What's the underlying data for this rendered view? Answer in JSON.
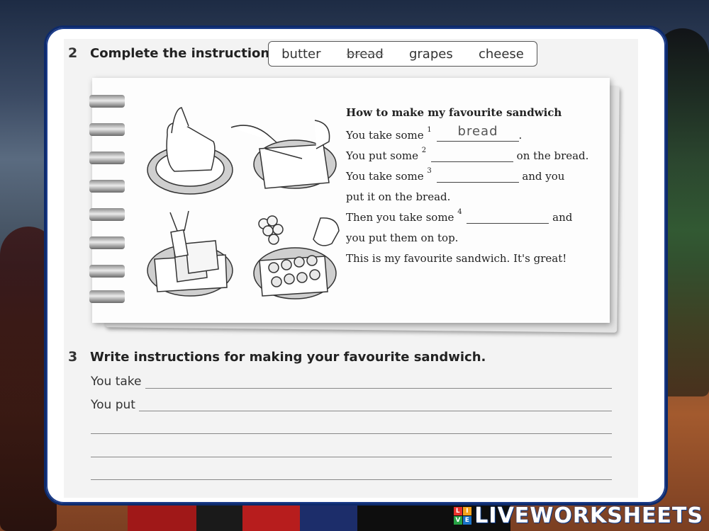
{
  "exercise2": {
    "number": "2",
    "heading": "Complete the instructions.",
    "word_bank": [
      "butter",
      "bread",
      "grapes",
      "cheese"
    ],
    "used_word_index": 1
  },
  "notebook": {
    "title": "How to make my favourite sandwich",
    "lines": [
      {
        "pre": "You take some",
        "num": "1",
        "post": ".",
        "answer": "bread"
      },
      {
        "pre": "You put some",
        "num": "2",
        "post": "on the bread.",
        "answer": ""
      },
      {
        "pre": "You take some",
        "num": "3",
        "post": "and you",
        "answer": ""
      },
      {
        "pre": "put it on the bread.",
        "num": "",
        "post": "",
        "answer": ""
      },
      {
        "pre": "Then you take some",
        "num": "4",
        "post": "and",
        "answer": ""
      },
      {
        "pre": "you put them on top.",
        "num": "",
        "post": "",
        "answer": ""
      },
      {
        "pre": "This is my favourite sandwich. It's great!",
        "num": "",
        "post": "",
        "answer": ""
      }
    ]
  },
  "exercise3": {
    "number": "3",
    "heading": "Write instructions for making your favourite sandwich.",
    "line1_label": "You take",
    "line2_label": "You put"
  },
  "brand": {
    "live": "LIVE",
    "name": "LIVEWORKSHEETS"
  }
}
